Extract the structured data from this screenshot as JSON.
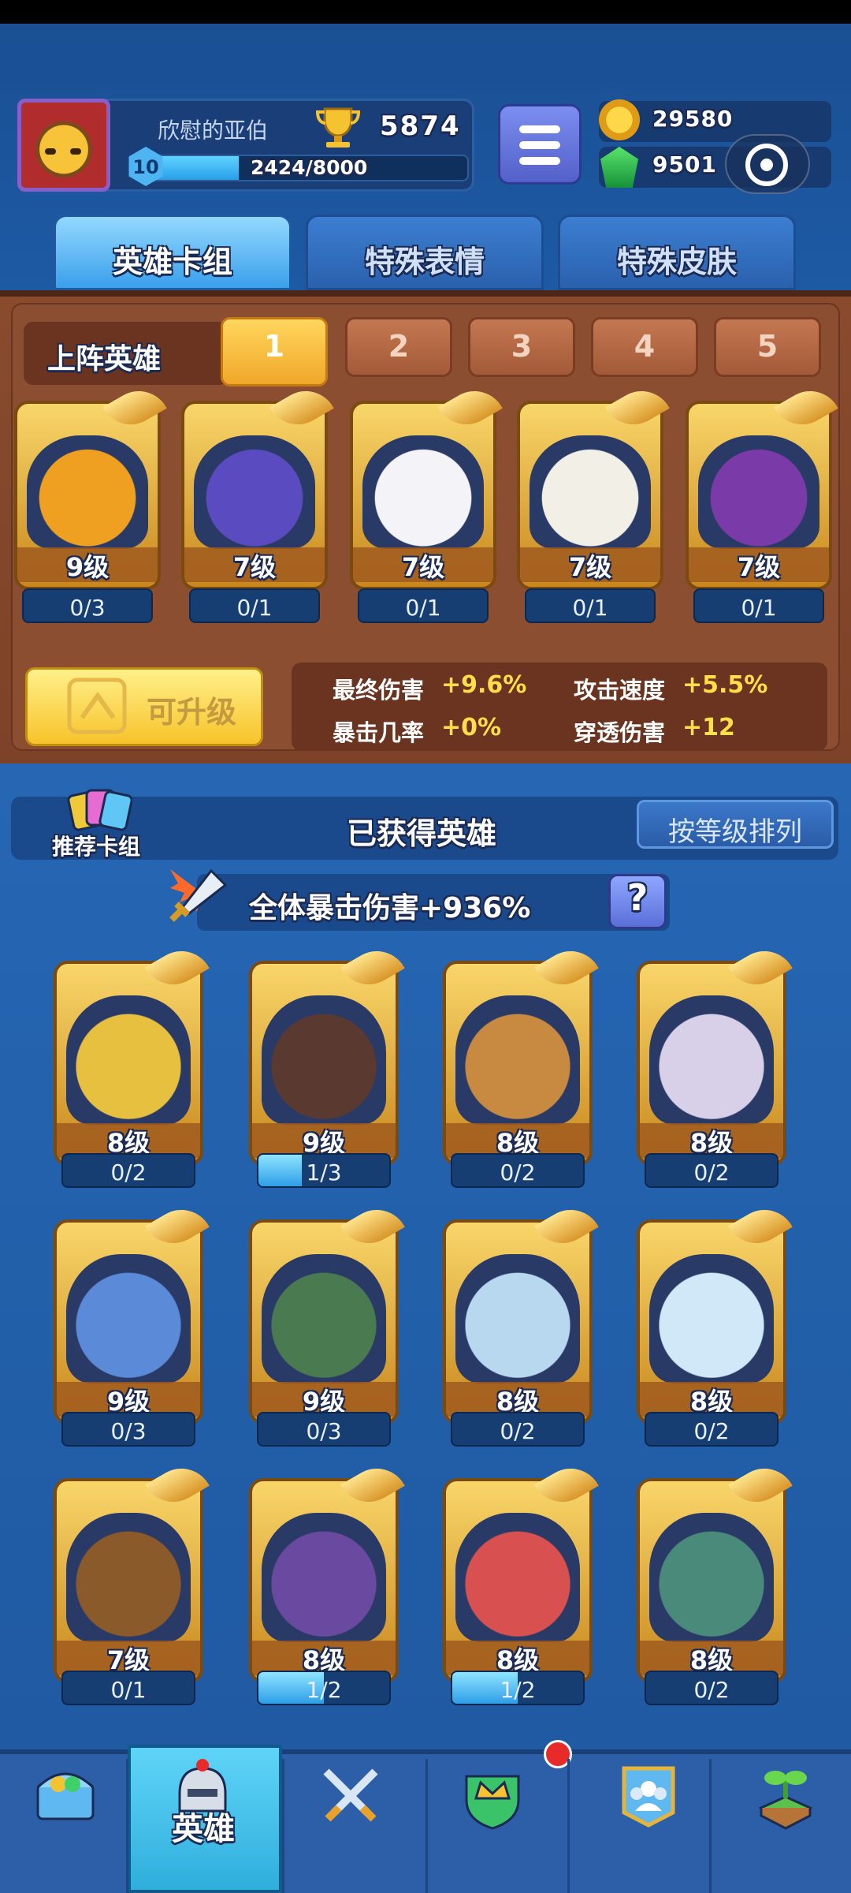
{
  "profile": {
    "name": "欣慰的亚伯",
    "trophies": "5874",
    "level": "10",
    "xp": "2424/8000",
    "xp_fraction": 0.303
  },
  "currency": {
    "coins": "29580",
    "gems": "9501"
  },
  "tabs": [
    "英雄卡组",
    "特殊表情",
    "特殊皮肤"
  ],
  "squad": {
    "label": "上阵英雄",
    "slots": [
      "1",
      "2",
      "3",
      "4",
      "5"
    ],
    "heroes": [
      {
        "level": "9级",
        "progress": "0/3",
        "fill": 0
      },
      {
        "level": "7级",
        "progress": "0/1",
        "fill": 0
      },
      {
        "level": "7级",
        "progress": "0/1",
        "fill": 0
      },
      {
        "level": "7级",
        "progress": "0/1",
        "fill": 0
      },
      {
        "level": "7级",
        "progress": "0/1",
        "fill": 0
      }
    ],
    "upgrade_label": "可升级",
    "stats": [
      {
        "label": "最终伤害",
        "value": "+9.6%"
      },
      {
        "label": "攻击速度",
        "value": "+5.5%"
      },
      {
        "label": "暴击几率",
        "value": "+0%"
      },
      {
        "label": "穿透伤害",
        "value": "+12"
      }
    ]
  },
  "collection": {
    "recommend_label": "推荐卡组",
    "title": "已获得英雄",
    "sort_label": "按等级排列",
    "crit_bonus": "全体暴击伤害+936%",
    "help": "?",
    "heroes": [
      {
        "level": "8级",
        "progress": "0/2",
        "fill": 0
      },
      {
        "level": "9级",
        "progress": "1/3",
        "fill": 0.33
      },
      {
        "level": "8级",
        "progress": "0/2",
        "fill": 0
      },
      {
        "level": "8级",
        "progress": "0/2",
        "fill": 0
      },
      {
        "level": "9级",
        "progress": "0/3",
        "fill": 0
      },
      {
        "level": "9级",
        "progress": "0/3",
        "fill": 0
      },
      {
        "level": "8级",
        "progress": "0/2",
        "fill": 0
      },
      {
        "level": "8级",
        "progress": "0/2",
        "fill": 0
      },
      {
        "level": "7级",
        "progress": "0/1",
        "fill": 0
      },
      {
        "level": "8级",
        "progress": "1/2",
        "fill": 0.5
      },
      {
        "level": "8级",
        "progress": "1/2",
        "fill": 0.5
      },
      {
        "level": "8级",
        "progress": "0/2",
        "fill": 0
      }
    ]
  },
  "nav": {
    "items": [
      "treasure-chest-icon",
      "helmet-icon",
      "crossed-swords-icon",
      "crown-shield-icon",
      "group-icon",
      "sprout-icon"
    ],
    "active_label": "英雄"
  },
  "colors": {
    "gold": "#ffe04a",
    "accent_blue": "#2a9ee8",
    "wood": "#8c4e31"
  }
}
